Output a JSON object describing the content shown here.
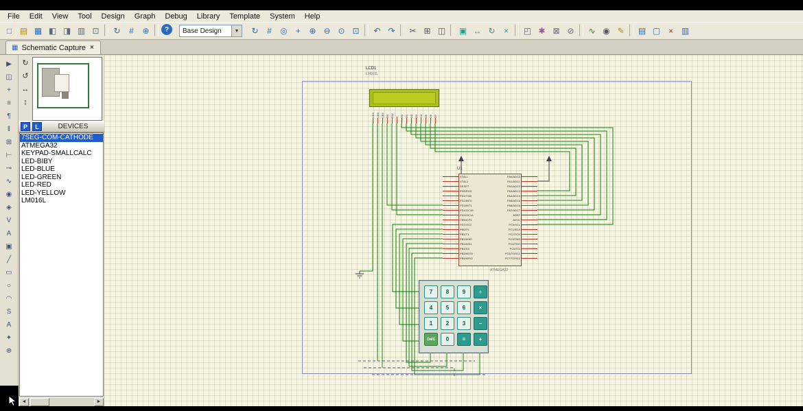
{
  "colors": {
    "selection_blue": "#1d5dd0",
    "wire_green": "#0e8410",
    "lcd_green": "#afc11c",
    "canvas_beige": "#f8f5e3",
    "keypad_teal": "#2d9b90"
  },
  "menubar": {
    "items": [
      {
        "name": "menu-file",
        "label": "File"
      },
      {
        "name": "menu-edit",
        "label": "Edit"
      },
      {
        "name": "menu-view",
        "label": "View"
      },
      {
        "name": "menu-tool",
        "label": "Tool"
      },
      {
        "name": "menu-design",
        "label": "Design"
      },
      {
        "name": "menu-graph",
        "label": "Graph"
      },
      {
        "name": "menu-debug",
        "label": "Debug"
      },
      {
        "name": "menu-library",
        "label": "Library"
      },
      {
        "name": "menu-template",
        "label": "Template"
      },
      {
        "name": "menu-system",
        "label": "System"
      },
      {
        "name": "menu-help",
        "label": "Help"
      }
    ]
  },
  "toolbar": {
    "left_icons": [
      {
        "name": "new-design-icon",
        "glyph": "□",
        "color": "#5a6a7a"
      },
      {
        "name": "open-design-icon",
        "glyph": "▤",
        "color": "#b8860b"
      },
      {
        "name": "save-design-icon",
        "glyph": "▦",
        "color": "#2a6ac0"
      },
      {
        "name": "import-section-icon",
        "glyph": "◧",
        "color": "#5a6a7a"
      },
      {
        "name": "export-section-icon",
        "glyph": "◨",
        "color": "#5a6a7a"
      },
      {
        "name": "print-design-icon",
        "glyph": "▥",
        "color": "#5a6a7a"
      },
      {
        "name": "mark-output-area-icon",
        "glyph": "⊡",
        "color": "#5a6a7a"
      },
      {
        "name": "toolbar-separator",
        "cls": "sep",
        "interactable": false
      },
      {
        "name": "refresh-display-icon",
        "glyph": "↻",
        "color": "#2a6ac0"
      },
      {
        "name": "toggle-grid-icon",
        "glyph": "#",
        "color": "#2a6ac0"
      },
      {
        "name": "false-origin-icon",
        "glyph": "⊕",
        "color": "#2a6ac0"
      },
      {
        "name": "toolbar-separator",
        "cls": "sep",
        "interactable": false
      },
      {
        "name": "help-icon",
        "glyph": "?",
        "cls": "round"
      }
    ],
    "sheet_selector": {
      "value": "Base Design",
      "arrow": "▼"
    },
    "right_icons": [
      {
        "name": "redraw-icon",
        "glyph": "↻",
        "color": "#2a6ac0"
      },
      {
        "name": "grid-icon",
        "glyph": "#",
        "color": "#2a6ac0"
      },
      {
        "name": "origin-icon",
        "glyph": "◎",
        "color": "#2a6ac0"
      },
      {
        "name": "center-at-cursor-icon",
        "glyph": "+",
        "color": "#2a6ac0"
      },
      {
        "name": "zoom-in-icon",
        "glyph": "⊕",
        "color": "#2a6ac0"
      },
      {
        "name": "zoom-out-icon",
        "glyph": "⊖",
        "color": "#2a6ac0"
      },
      {
        "name": "zoom-all-icon",
        "glyph": "⊙",
        "color": "#2a6ac0"
      },
      {
        "name": "zoom-to-area-icon",
        "glyph": "⊡",
        "color": "#2a6ac0"
      },
      {
        "name": "toolbar-separator",
        "cls": "sep",
        "interactable": false
      },
      {
        "name": "undo-icon",
        "glyph": "↶",
        "color": "#2a6ac0"
      },
      {
        "name": "redo-icon",
        "glyph": "↷",
        "color": "#2a6ac0"
      },
      {
        "name": "toolbar-separator",
        "cls": "sep",
        "interactable": false
      },
      {
        "name": "cut-icon",
        "glyph": "✂",
        "color": "#555566"
      },
      {
        "name": "copy-icon",
        "glyph": "⊞",
        "color": "#555566"
      },
      {
        "name": "paste-icon",
        "glyph": "◫",
        "color": "#555566"
      },
      {
        "name": "toolbar-separator",
        "cls": "sep",
        "interactable": false
      },
      {
        "name": "block-copy-icon",
        "glyph": "▣",
        "color": "#2a9d8f"
      },
      {
        "name": "block-move-icon",
        "glyph": "↔",
        "color": "#2a9d8f"
      },
      {
        "name": "block-rotate-icon",
        "glyph": "↻",
        "color": "#2a9d8f"
      },
      {
        "name": "block-delete-icon",
        "glyph": "×",
        "color": "#2a9d8f"
      },
      {
        "name": "toolbar-separator",
        "cls": "sep",
        "interactable": false
      },
      {
        "name": "pick-parts-icon",
        "glyph": "◰",
        "color": "#666677"
      },
      {
        "name": "make-device-icon",
        "glyph": "✱",
        "color": "#a0529a"
      },
      {
        "name": "packaging-tool-icon",
        "glyph": "⊠",
        "color": "#666677"
      },
      {
        "name": "decompose-icon",
        "glyph": "⊘",
        "color": "#666677"
      },
      {
        "name": "toolbar-separator",
        "cls": "sep",
        "interactable": false
      },
      {
        "name": "wire-autorouter-icon",
        "glyph": "∿",
        "color": "#1f8a1f"
      },
      {
        "name": "search-tag-icon",
        "glyph": "◉",
        "color": "#555566"
      },
      {
        "name": "property-assignment-icon",
        "glyph": "✎",
        "color": "#b8860b"
      },
      {
        "name": "toolbar-separator",
        "cls": "sep",
        "interactable": false
      },
      {
        "name": "design-explorer-icon",
        "glyph": "▤",
        "color": "#2a6ac0"
      },
      {
        "name": "new-sheet-icon",
        "glyph": "▢",
        "color": "#2a6ac0"
      },
      {
        "name": "remove-sheet-icon",
        "glyph": "×",
        "color": "#c03028"
      },
      {
        "name": "goto-sheet-icon",
        "glyph": "▥",
        "color": "#2a6ac0"
      }
    ]
  },
  "tabbar": {
    "tab": {
      "icon": "▦",
      "label": "Schematic Capture",
      "close": "×"
    }
  },
  "toolstrip": {
    "items": [
      {
        "name": "selection-mode-icon",
        "glyph": "▶"
      },
      {
        "name": "component-mode-icon",
        "glyph": "◫"
      },
      {
        "name": "junction-dot-mode-icon",
        "glyph": "+"
      },
      {
        "name": "wire-label-mode-icon",
        "glyph": "≡"
      },
      {
        "name": "text-script-mode-icon",
        "glyph": "¶"
      },
      {
        "name": "buses-mode-icon",
        "glyph": "‖"
      },
      {
        "name": "subcircuit-mode-icon",
        "glyph": "⊞"
      },
      {
        "name": "terminals-mode-icon",
        "glyph": "⊢"
      },
      {
        "name": "device-pins-mode-icon",
        "glyph": "⊸"
      },
      {
        "name": "graph-mode-icon",
        "glyph": "∿"
      },
      {
        "name": "tape-recorder-mode-icon",
        "glyph": "◉"
      },
      {
        "name": "generator-mode-icon",
        "glyph": "◈"
      },
      {
        "name": "voltage-probe-mode-icon",
        "glyph": "V"
      },
      {
        "name": "current-probe-mode-icon",
        "glyph": "A"
      },
      {
        "name": "virtual-instruments-mode-icon",
        "glyph": "▣"
      },
      {
        "name": "2d-line-icon",
        "glyph": "╱"
      },
      {
        "name": "2d-box-icon",
        "glyph": "▭"
      },
      {
        "name": "2d-circle-icon",
        "glyph": "○"
      },
      {
        "name": "2d-arc-icon",
        "glyph": "◠"
      },
      {
        "name": "2d-path-icon",
        "glyph": "S"
      },
      {
        "name": "2d-text-icon",
        "glyph": "A"
      },
      {
        "name": "2d-symbol-icon",
        "glyph": "✦"
      },
      {
        "name": "2d-marker-icon",
        "glyph": "⊕"
      }
    ]
  },
  "orientation": {
    "items": [
      {
        "name": "rotate-clockwise-icon",
        "glyph": "↻"
      },
      {
        "name": "rotate-anticlockwise-icon",
        "glyph": "↺"
      },
      {
        "name": "mirror-horizontal-icon",
        "glyph": "↔"
      },
      {
        "name": "mirror-vertical-icon",
        "glyph": "↕"
      }
    ]
  },
  "devices_panel": {
    "pick_button": "P",
    "library_button": "L",
    "header": "DEVICES",
    "items": [
      {
        "label": "7SEG-COM-CATHODE",
        "cls": "selected"
      },
      {
        "label": "ATMEGA32"
      },
      {
        "label": "KEYPAD-SMALLCALC"
      },
      {
        "label": "LED-BIBY"
      },
      {
        "label": "LED-BLUE"
      },
      {
        "label": "LED-GREEN"
      },
      {
        "label": "LED-RED"
      },
      {
        "label": "LED-YELLOW"
      },
      {
        "label": "LM016L"
      }
    ],
    "scrollbar": {
      "left_arrow": "◄",
      "right_arrow": "►"
    }
  },
  "schematic": {
    "lcd": {
      "ref": "LCD1",
      "part": "LM016L",
      "pins": [
        "VSS",
        "VDD",
        "VEE",
        "RS",
        "RW",
        "E",
        "D0",
        "D1",
        "D2",
        "D3",
        "D4",
        "D5",
        "D6",
        "D7"
      ]
    },
    "mcu": {
      "ref": "U1",
      "part": "ATMEGA32",
      "left_pins": [
        "XTAL1",
        "XTAL2",
        "RESET",
        "PD0/RXD",
        "PD1/TXD",
        "PD2/INT0",
        "PD3/INT1",
        "PD4/OC1B",
        "PD5/OC1A",
        "PD6/ICP1",
        "PD7/OC2",
        "PB0/T0",
        "PB1/T1",
        "PB2/AIN0",
        "PB3/AIN1",
        "PB4/SS",
        "PB5/MOSI",
        "PB6/MISO"
      ],
      "right_pins": [
        "PA0/ADC0",
        "PA1/ADC1",
        "PA2/ADC2",
        "PA3/ADC3",
        "PA4/ADC4",
        "PA5/ADC5",
        "PA6/ADC6",
        "PA7/ADC7",
        "AREF",
        "AVCC",
        "PC0/SCL",
        "PC1/SDA",
        "PC2/TCK",
        "PC3/TMS",
        "PC4/TDO",
        "PC5/TDI",
        "PC6/TOSC1",
        "PC7/TOSC2"
      ]
    },
    "keypad": {
      "keys": [
        {
          "label": "7"
        },
        {
          "label": "8"
        },
        {
          "label": "9"
        },
        {
          "label": "÷",
          "cls": "fn"
        },
        {
          "label": "4"
        },
        {
          "label": "5"
        },
        {
          "label": "6"
        },
        {
          "label": "×",
          "cls": "fn"
        },
        {
          "label": "1"
        },
        {
          "label": "2"
        },
        {
          "label": "3"
        },
        {
          "label": "−",
          "cls": "fn"
        },
        {
          "label": "ON/C",
          "cls": "on"
        },
        {
          "label": "0"
        },
        {
          "label": "=",
          "cls": "fn"
        },
        {
          "label": "+",
          "cls": "fn"
        }
      ]
    }
  }
}
